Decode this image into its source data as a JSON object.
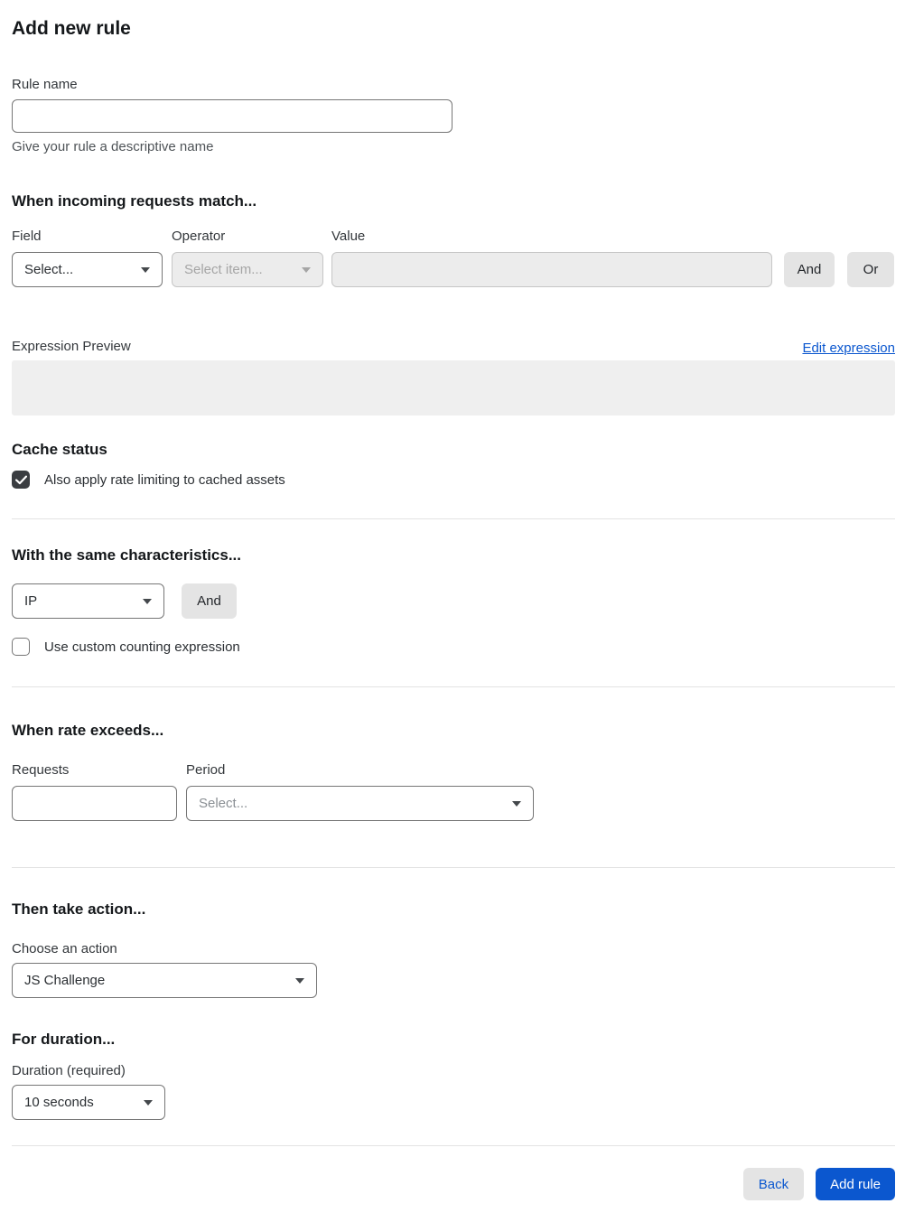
{
  "title": "Add new rule",
  "rule_name": {
    "label": "Rule name",
    "value": "",
    "helper": "Give your rule a descriptive name"
  },
  "match": {
    "heading": "When incoming requests match...",
    "field_label": "Field",
    "field_value": "Select...",
    "operator_label": "Operator",
    "operator_value": "Select item...",
    "value_label": "Value",
    "value_value": "",
    "and_label": "And",
    "or_label": "Or",
    "preview_label": "Expression Preview",
    "edit_link": "Edit expression",
    "preview_content": ""
  },
  "cache": {
    "heading": "Cache status",
    "checkbox_label": "Also apply rate limiting to cached assets",
    "checked": true
  },
  "characteristics": {
    "heading": "With the same characteristics...",
    "select_value": "IP",
    "and_label": "And",
    "checkbox_label": "Use custom counting expression",
    "checked": false
  },
  "rate": {
    "heading": "When rate exceeds...",
    "requests_label": "Requests",
    "requests_value": "",
    "period_label": "Period",
    "period_value": "Select..."
  },
  "action": {
    "heading": "Then take action...",
    "label": "Choose an action",
    "value": "JS Challenge"
  },
  "duration": {
    "heading": "For duration...",
    "label": "Duration (required)",
    "value": "10 seconds"
  },
  "footer": {
    "back": "Back",
    "add_rule": "Add rule"
  },
  "colors": {
    "accent_blue": "#0b57cf",
    "disabled_bg": "#ececec",
    "checkbox_checked": "#3a3d41",
    "divider": "#e3e3e3",
    "preview_box": "#efefef"
  }
}
